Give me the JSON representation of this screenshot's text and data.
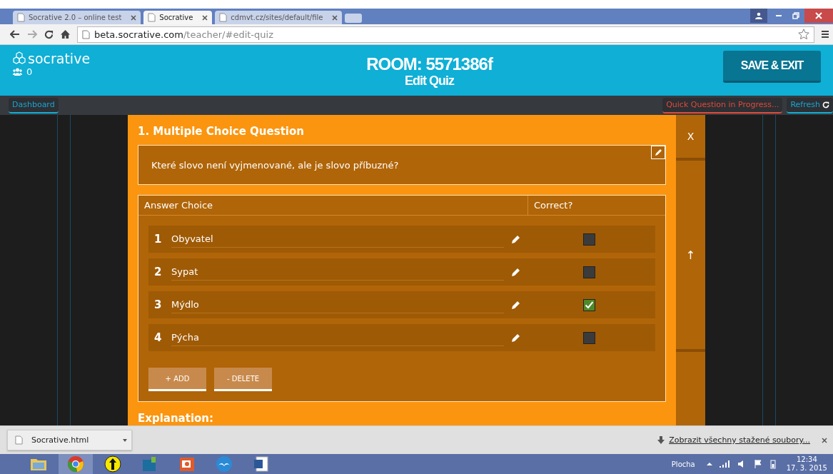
{
  "browser": {
    "tabs": [
      {
        "title": "Socrative 2.0 – online test",
        "selected": false
      },
      {
        "title": "Socrative",
        "selected": true
      },
      {
        "title": "cdmvt.cz/sites/default/file",
        "selected": false
      }
    ],
    "url_host": "beta.socrative.com",
    "url_path": "/teacher/#edit-quiz"
  },
  "header": {
    "logo": "socrative",
    "student_count": "0",
    "room": "ROOM: 5571386f",
    "subtitle": "Edit Quiz",
    "save_button": "SAVE & EXIT"
  },
  "nav": {
    "dashboard": "Dashboard",
    "quick_question": "Quick Question in Progress...",
    "refresh": "Refresh"
  },
  "question": {
    "title": "1. Multiple Choice Question",
    "text": "Které slovo není vyjmenované, ale je slovo příbuzné?",
    "columns": [
      "Answer Choice",
      "Correct?"
    ],
    "answers": [
      {
        "number": "1",
        "text": "Obyvatel",
        "checked": false
      },
      {
        "number": "2",
        "text": "Sypat",
        "checked": false
      },
      {
        "number": "3",
        "text": "Mýdlo",
        "checked": true
      },
      {
        "number": "4",
        "text": "Pýcha",
        "checked": false
      }
    ],
    "add": "+ ADD",
    "delete": "- DELETE",
    "explanation": "Explanation:",
    "close": "X",
    "move_up": "↑"
  },
  "downloads": {
    "file": "Socrative.html",
    "show_all": "Zobrazit všechny stažené soubory..."
  },
  "taskbar": {
    "desktop": "Plocha",
    "time": "12:34",
    "date": "17. 3. 2015"
  }
}
